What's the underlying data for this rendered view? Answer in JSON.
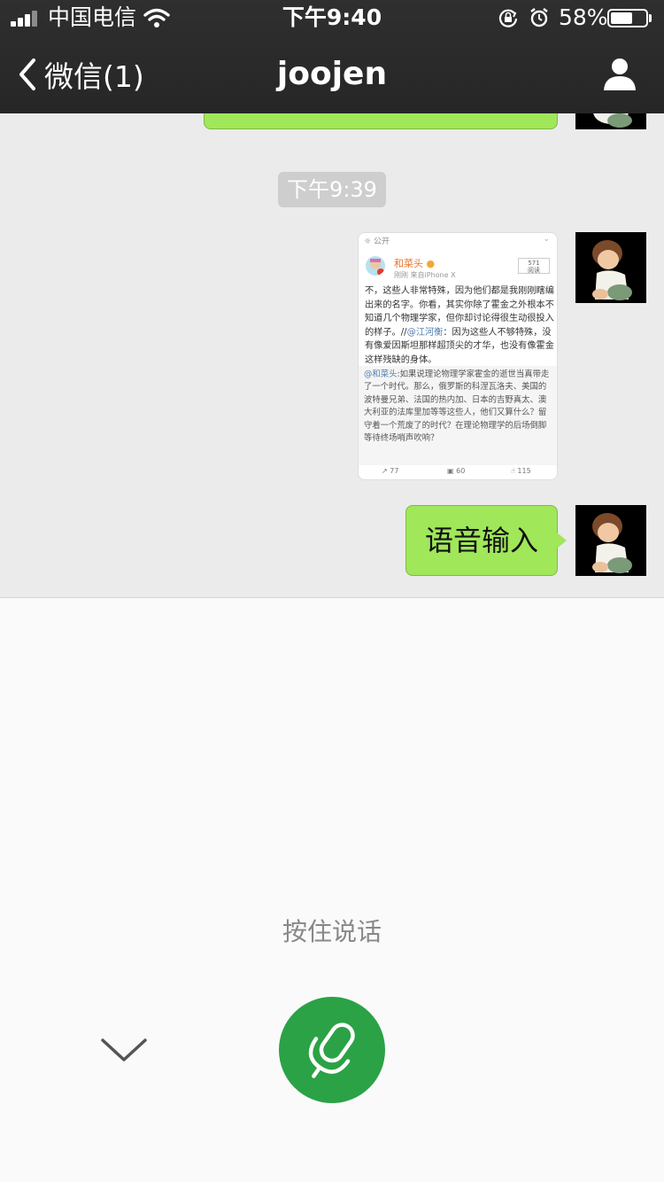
{
  "status_bar": {
    "carrier": "中国电信",
    "time": "下午9:40",
    "battery_percent": "58%",
    "battery_level": 0.58
  },
  "nav": {
    "back_label": "微信(1)",
    "title": "joojen"
  },
  "chat": {
    "timestamp": "下午9:39",
    "weibo_card": {
      "visibility": "公开",
      "author": "和菜头",
      "meta": "刚刚  来自iPhone X",
      "reads_count": "571",
      "reads_label": "阅读",
      "text_main": "不，这些人非常特殊，因为他们都是我刚刚瞎编出来的名字。你看，其实你除了霍金之外根本不知道几个物理学家，但你却讨论得很生动很投入的样子。//",
      "mention_1": "@江河衡",
      "text_after_mention": "：因为这些人不够特殊，没有像爱因斯坦那样超顶尖的才华，也没有像霍金这样残缺的身体。",
      "repost_mention": "@和菜头",
      "repost_text": ":如果说理论物理学家霍金的逝世当真带走了一个时代。那么，俄罗斯的科涅瓦洛夫、美国的波特曼兄弟、法国的热内加、日本的吉野真太、澳大利亚的法库里加等等这些人，他们又算什么？留守着一个荒废了的时代？在理论物理学的后场倒脚等待终场哨声吹响？",
      "reposts": "77",
      "comments": "60",
      "likes": "115"
    },
    "voice_message": "语音输入"
  },
  "voice_panel": {
    "hint": "按住说话"
  },
  "colors": {
    "bubble_green": "#a0e75a",
    "mic_green": "#2ba245",
    "nav_bg": "#2b2b2b",
    "chat_bg": "#ebebeb"
  },
  "icons": [
    "signal-icon",
    "wifi-icon",
    "rotation-lock-icon",
    "alarm-icon",
    "battery-icon",
    "back-chevron-icon",
    "profile-icon",
    "collapse-chevron-icon",
    "microphone-icon"
  ]
}
